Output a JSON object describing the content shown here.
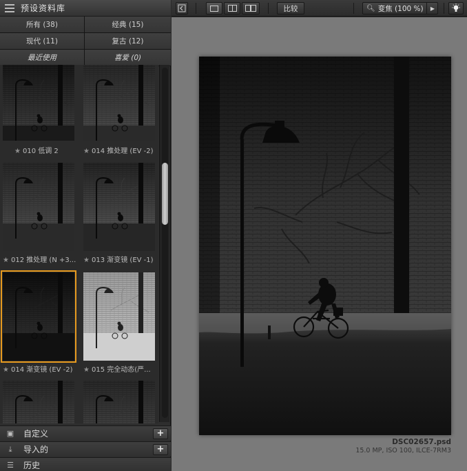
{
  "sidebar": {
    "title": "预设资料库",
    "filters": [
      {
        "label": "所有 (38)",
        "italic": false
      },
      {
        "label": "经典 (15)",
        "italic": false
      },
      {
        "label": "现代 (11)",
        "italic": false
      },
      {
        "label": "复古 (12)",
        "italic": false
      },
      {
        "label": "最近使用",
        "italic": true
      },
      {
        "label": "喜爱 (0)",
        "italic": true
      }
    ],
    "thumbnails": [
      {
        "label": "010 低调 2",
        "variant": "dark",
        "selected": false
      },
      {
        "label": "014 推处理 (EV -2)",
        "variant": "normal",
        "selected": false
      },
      {
        "label": "012 推处理 (N +3...",
        "variant": "normal",
        "selected": false
      },
      {
        "label": "013 渐变镜 (EV -1)",
        "variant": "gradient",
        "selected": false
      },
      {
        "label": "014 渐变镜 (EV -2)",
        "variant": "verydark",
        "selected": true
      },
      {
        "label": "015 完全动态(严...",
        "variant": "bright",
        "selected": false
      },
      {
        "label": "",
        "variant": "normal",
        "selected": false
      },
      {
        "label": "",
        "variant": "normal",
        "selected": false
      }
    ],
    "star_glyph": "★",
    "sections": [
      {
        "label": "自定义",
        "icon": "custom-icon"
      },
      {
        "label": "导入的",
        "icon": "import-icon"
      },
      {
        "label": "历史",
        "icon": "history-icon"
      }
    ],
    "plus_glyph": "+"
  },
  "toolbar": {
    "compare_label": "比较",
    "zoom_label": "变焦 (100 %)",
    "zoom_icon": "magnifier-icon"
  },
  "canvas": {
    "file_name": "DSC02657.psd",
    "file_meta": "15.0 MP, ISO 100, ILCE-7RM3"
  },
  "colors": {
    "accent_selected": "#e79a1e",
    "canvas_bg": "#7a7a7a",
    "panel_bg": "#2e2e2e"
  }
}
